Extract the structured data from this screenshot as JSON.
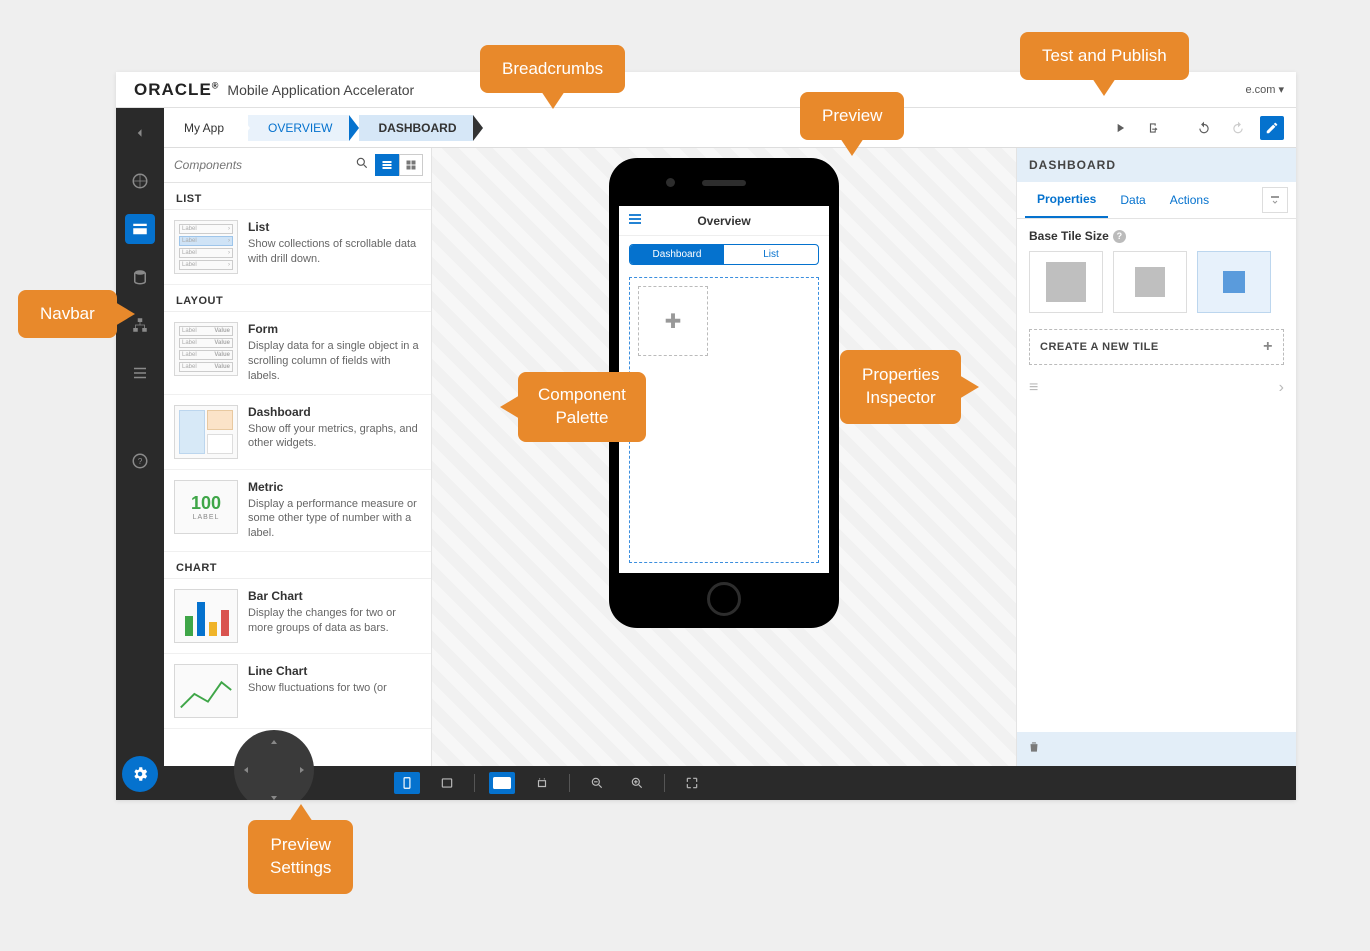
{
  "brand": {
    "logo_a": "ORACLE",
    "sup": "®",
    "sub": "Mobile Application Accelerator",
    "user_suffix": "e.com ▾"
  },
  "breadcrumbs": {
    "root": "My App",
    "level1": "OVERVIEW",
    "level2": "DASHBOARD"
  },
  "palette": {
    "search_placeholder": "Components",
    "sections": {
      "list": "LIST",
      "layout": "LAYOUT",
      "chart": "CHART"
    },
    "items": {
      "list": {
        "title": "List",
        "desc": "Show collections of scrollable data with drill down."
      },
      "form": {
        "title": "Form",
        "desc": "Display data for a single object in a scrolling column of fields with labels."
      },
      "dashboard": {
        "title": "Dashboard",
        "desc": "Show off your metrics, graphs, and other widgets."
      },
      "metric": {
        "title": "Metric",
        "desc": "Display a performance measure or some other type of number with a label.",
        "thumb_value": "100",
        "thumb_label": "LABEL"
      },
      "bar": {
        "title": "Bar Chart",
        "desc": "Display the changes for two or more groups of data as bars."
      },
      "line": {
        "title": "Line Chart",
        "desc": "Show fluctuations for two (or"
      }
    },
    "thumb_label": "Label",
    "thumb_value": "Value"
  },
  "preview": {
    "header_title": "Overview",
    "tab_dashboard": "Dashboard",
    "tab_list": "List"
  },
  "props": {
    "title": "DASHBOARD",
    "tabs": {
      "properties": "Properties",
      "data": "Data",
      "actions": "Actions"
    },
    "base_tile_label": "Base Tile Size",
    "create_tile": "CREATE A NEW TILE"
  },
  "callouts": {
    "breadcrumbs": "Breadcrumbs",
    "test_publish": "Test and Publish",
    "preview": "Preview",
    "navbar": "Navbar",
    "component_palette": "Component Palette",
    "props_inspector": "Properties Inspector",
    "preview_settings": "Preview Settings"
  }
}
